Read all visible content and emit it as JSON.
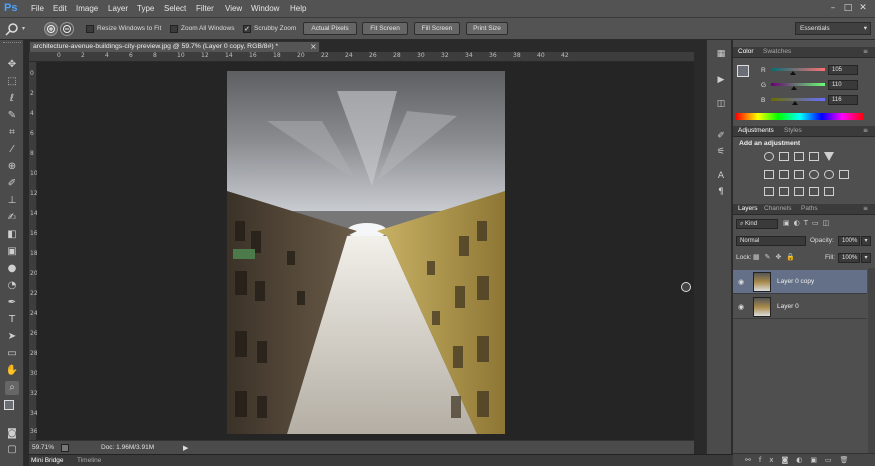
{
  "app": {
    "logo": "Ps",
    "menu": [
      "File",
      "Edit",
      "Image",
      "Layer",
      "Type",
      "Select",
      "Filter",
      "View",
      "Window",
      "Help"
    ],
    "window_controls": [
      "–",
      "□",
      "✕"
    ]
  },
  "options_bar": {
    "checkboxes": [
      "Resize Windows to Fit",
      "Zoom All Windows",
      "Scrubby Zoom"
    ],
    "buttons": [
      "Actual Pixels",
      "Fit Screen",
      "Fill Screen",
      "Print Size"
    ],
    "workspace": "Essentials"
  },
  "document": {
    "tab_title": "architecture-avenue-buildings-city-preview.jpg @ 59.7% (Layer 0 copy, RGB/8#) *",
    "close": "×",
    "ruler_h": [
      "0",
      "2",
      "4",
      "6",
      "8",
      "10",
      "12",
      "14",
      "16",
      "18",
      "20",
      "22",
      "24",
      "26",
      "28",
      "30",
      "32",
      "34",
      "36",
      "38",
      "40",
      "42"
    ],
    "ruler_v": [
      "0",
      "2",
      "4",
      "6",
      "8",
      "10",
      "12",
      "14",
      "16",
      "18",
      "20",
      "22",
      "24",
      "26",
      "28",
      "30",
      "32",
      "34",
      "36"
    ]
  },
  "status": {
    "zoom": "59.71%",
    "doc": "Doc: 1.96M/3.91M",
    "arrow": "▶"
  },
  "bottom_tabs": [
    "Mini Bridge",
    "Timeline"
  ],
  "panels": {
    "color": {
      "tabs": [
        "Color",
        "Swatches"
      ],
      "channels": [
        {
          "label": "R",
          "value": "105",
          "fraction": 0.41
        },
        {
          "label": "G",
          "value": "110",
          "fraction": 0.43
        },
        {
          "label": "B",
          "value": "116",
          "fraction": 0.45
        }
      ]
    },
    "adjustments": {
      "tabs": [
        "Adjustments",
        "Styles"
      ],
      "heading": "Add an adjustment"
    },
    "layers": {
      "tabs": [
        "Layers",
        "Channels",
        "Paths"
      ],
      "kind": "Kind",
      "blend_mode": "Normal",
      "opacity_label": "Opacity:",
      "opacity": "100%",
      "lock_label": "Lock:",
      "fill_label": "Fill:",
      "fill": "100%",
      "rows": [
        {
          "name": "Layer 0 copy",
          "selected": true
        },
        {
          "name": "Layer 0",
          "selected": false
        }
      ]
    }
  },
  "colors": {
    "accent_selected_layer": "#637087",
    "ps_logo": "#4aa3ff"
  }
}
